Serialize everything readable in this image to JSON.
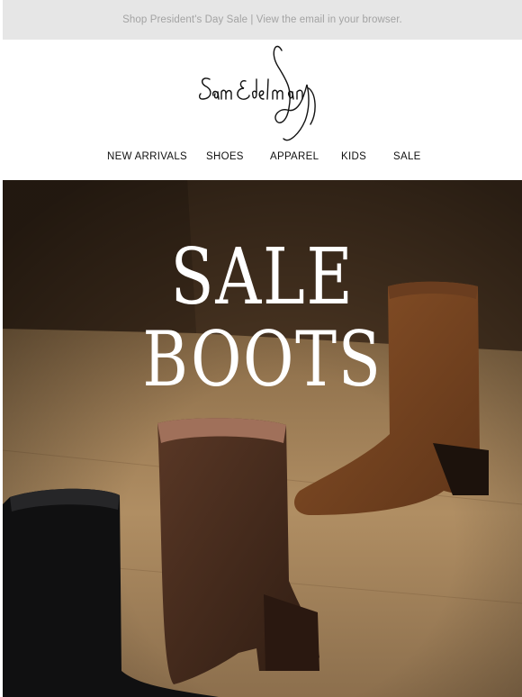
{
  "preheader": {
    "text": "Shop President's Day Sale | View the email in your browser."
  },
  "brand": {
    "logo_text": "Sam Edelman"
  },
  "nav": {
    "items": [
      {
        "label": "NEW ARRIVALS"
      },
      {
        "label": "SHOES"
      },
      {
        "label": "APPAREL"
      },
      {
        "label": "KIDS"
      },
      {
        "label": "SALE"
      }
    ]
  },
  "hero": {
    "line1": "SALE",
    "line2": "BOOTS",
    "image": "three-ankle-boots-on-wood-floor"
  },
  "colors": {
    "preheader_bg": "#e6e6e6",
    "preheader_text": "#a3a3a3",
    "nav_text": "#111111",
    "hero_text": "#ffffff"
  }
}
